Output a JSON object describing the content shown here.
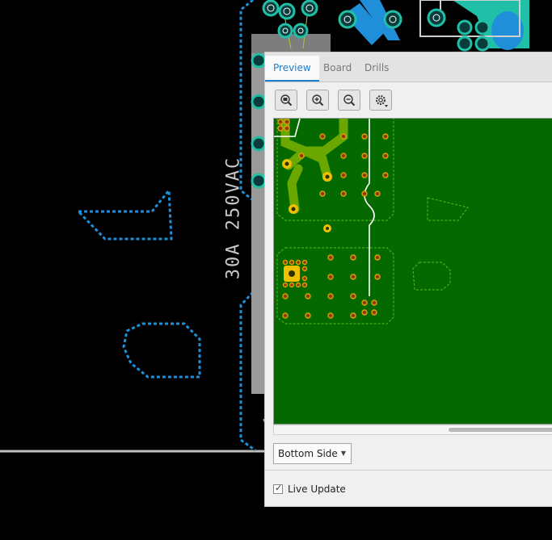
{
  "window": {
    "title": ""
  },
  "pcb_text": {
    "silkscreen_label": "30A 250VAC"
  },
  "panel": {
    "tabs": [
      {
        "label": "Preview",
        "active": true
      },
      {
        "label": "Board",
        "active": false
      },
      {
        "label": "Drills",
        "active": false
      }
    ],
    "toolbar": [
      {
        "icon": "zoom-fit-icon"
      },
      {
        "icon": "zoom-in-icon"
      },
      {
        "icon": "zoom-out-icon"
      },
      {
        "icon": "gear-icon"
      }
    ],
    "side_select": {
      "value": "Bottom Side"
    },
    "live_update": {
      "label": "Live Update",
      "checked": true
    }
  },
  "colors": {
    "background": "#000000",
    "board_green": "#046a00",
    "copper_trace": "#6aa800",
    "pad_yellow": "#f0c000",
    "outline_blue": "#1e8fd8",
    "teal_copper": "#1fbfa8",
    "accent_tab": "#1e7fd0"
  }
}
